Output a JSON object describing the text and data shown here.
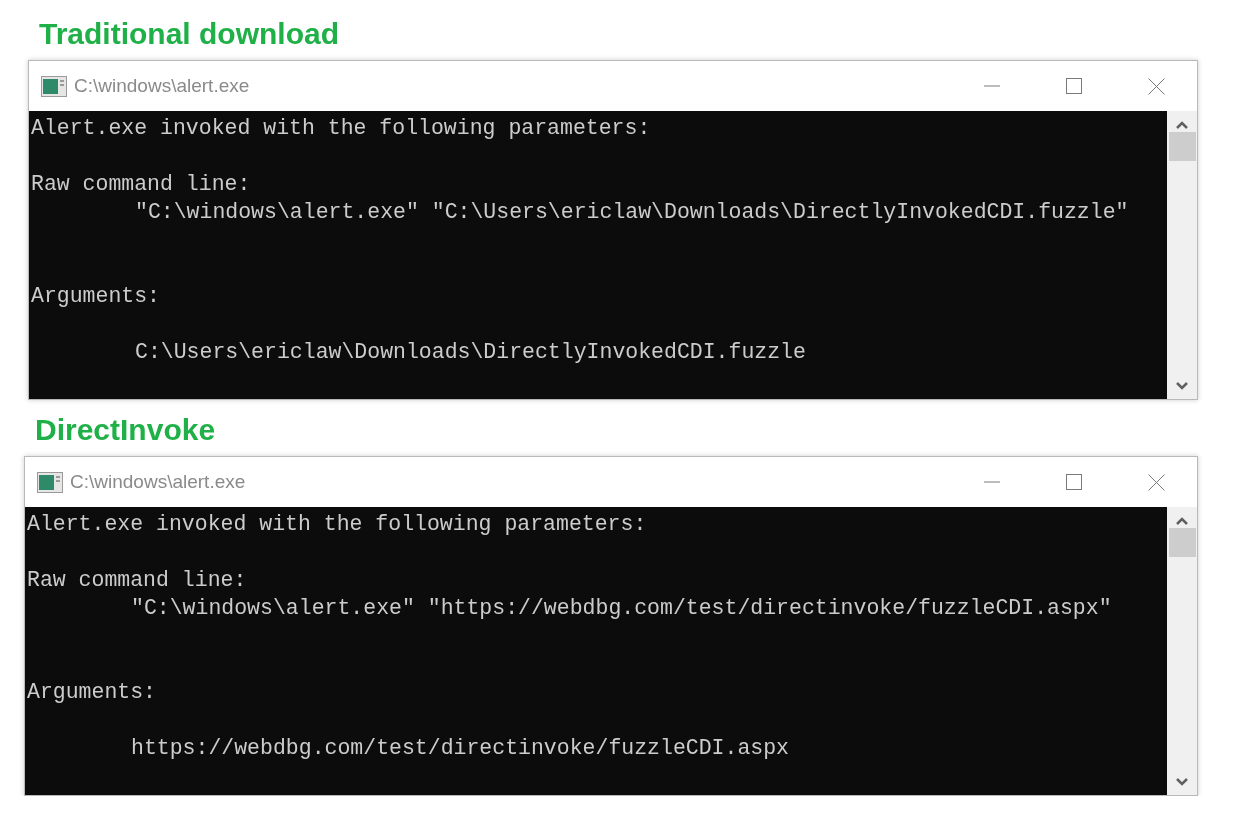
{
  "sections": [
    {
      "heading": "Traditional download",
      "window": {
        "title": "C:\\windows\\alert.exe",
        "lines": [
          {
            "kind": "summary",
            "text": "Alert.exe invoked with the following parameters:"
          },
          {
            "kind": "label",
            "text": "Raw command line:"
          },
          {
            "kind": "command",
            "text": "\"C:\\windows\\alert.exe\" \"C:\\Users\\ericlaw\\Downloads\\DirectlyInvokedCDI.fuzzle\""
          },
          {
            "kind": "section",
            "text": "Arguments:"
          },
          {
            "kind": "argument",
            "text": "C:\\Users\\ericlaw\\Downloads\\DirectlyInvokedCDI.fuzzle"
          }
        ]
      }
    },
    {
      "heading": "DirectInvoke",
      "window": {
        "title": "C:\\windows\\alert.exe",
        "lines": [
          {
            "kind": "summary",
            "text": "Alert.exe invoked with the following parameters:"
          },
          {
            "kind": "label",
            "text": "Raw command line:"
          },
          {
            "kind": "command",
            "text": "\"C:\\windows\\alert.exe\" \"https://webdbg.com/test/directinvoke/fuzzleCDI.aspx\""
          },
          {
            "kind": "section",
            "text": "Arguments:"
          },
          {
            "kind": "argument",
            "text": "https://webdbg.com/test/directinvoke/fuzzleCDI.aspx"
          }
        ]
      }
    }
  ]
}
